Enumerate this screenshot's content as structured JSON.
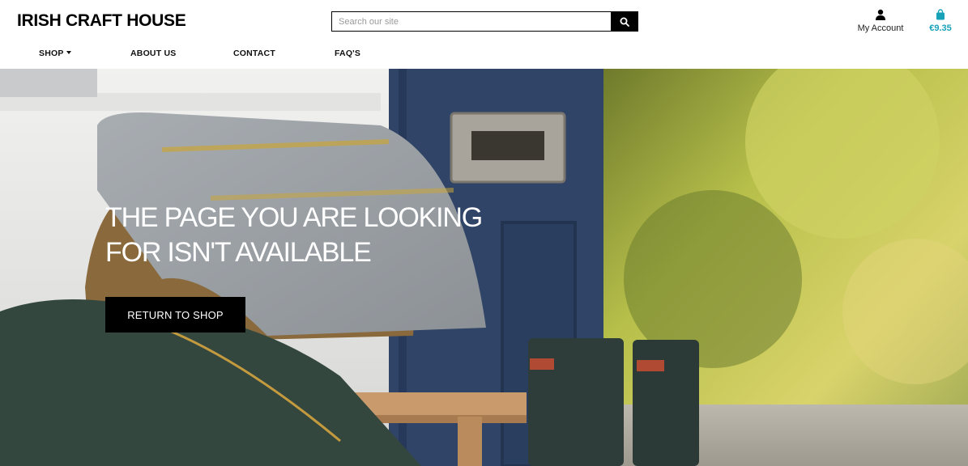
{
  "header": {
    "logo": "IRISH CRAFT HOUSE",
    "search": {
      "placeholder": "Search our site",
      "value": "",
      "button_icon": "search-icon"
    },
    "account": {
      "label": "My Account",
      "icon": "user-icon"
    },
    "bag": {
      "total": "€9.35",
      "icon": "shopping-bag-icon",
      "color": "#17a2b8"
    }
  },
  "nav": {
    "items": [
      {
        "label": "SHOP",
        "has_dropdown": true
      },
      {
        "label": "ABOUT US"
      },
      {
        "label": "CONTACT"
      },
      {
        "label": "FAQ'S"
      }
    ]
  },
  "hero": {
    "title": "THE PAGE YOU ARE LOOKING FOR ISN'T AVAILABLE",
    "button_label": "RETURN TO SHOP"
  }
}
